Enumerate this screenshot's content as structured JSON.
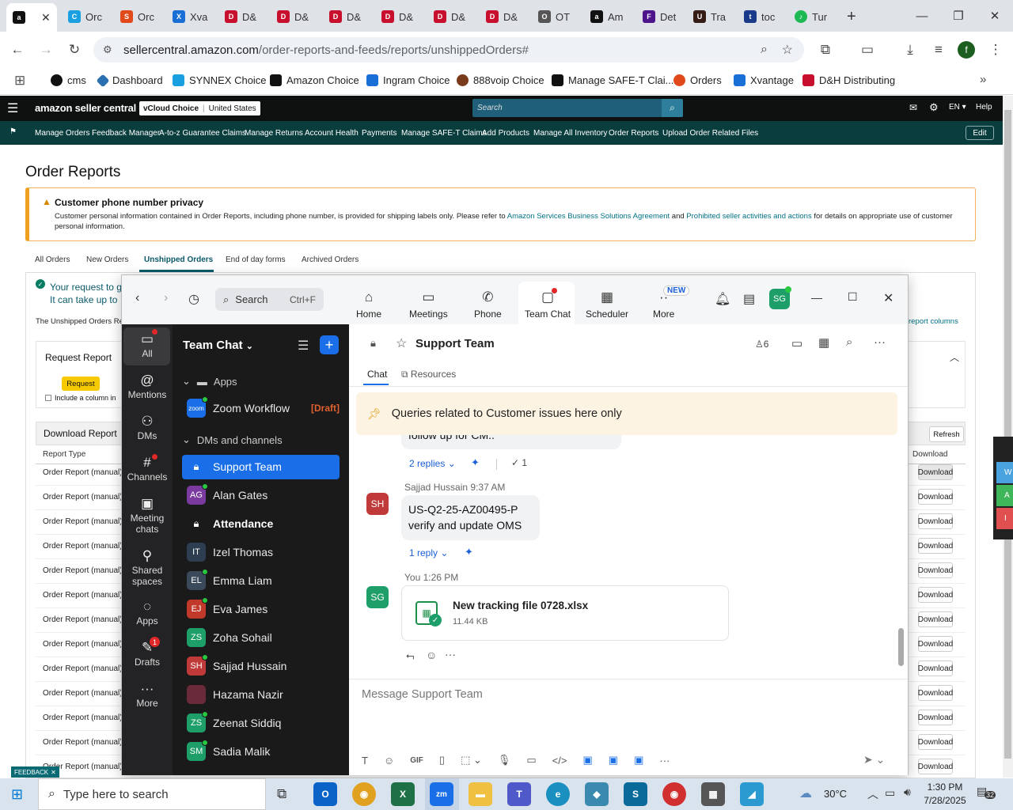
{
  "browser": {
    "tabs": [
      "Orc",
      "Orc",
      "Xva",
      "D&",
      "D&",
      "D&",
      "D&",
      "D&",
      "D&",
      "OT",
      "Am",
      "Det",
      "Tra",
      "toc",
      "Tur"
    ],
    "url_host": "sellercentral.amazon.com",
    "url_path": "/order-reports-and-feeds/reports/unshippedOrders#",
    "bookmarks": [
      "cms",
      "Dashboard",
      "SYNNEX Choice",
      "Amazon Choice",
      "Ingram Choice",
      "888voip Choice",
      "Manage SAFE-T Clai...",
      "Orders",
      "Xvantage",
      "D&H Distributing"
    ],
    "profile_initial": "f"
  },
  "amazon": {
    "logo": "amazon seller central",
    "account": "vCloud Choice",
    "region": "United States",
    "search_placeholder": "Search",
    "lang": "EN",
    "help": "Help",
    "nav": [
      "Manage Orders",
      "Feedback Manager",
      "A-to-z Guarantee Claims",
      "Manage Returns",
      "Account Health",
      "Payments",
      "Manage SAFE-T Claims",
      "Add Products",
      "Manage All Inventory",
      "Order Reports",
      "Upload Order Related Files"
    ],
    "edit": "Edit",
    "page_title": "Order Reports",
    "privacy_title": "Customer phone number privacy",
    "privacy_text_1": "Customer personal information contained in Order Reports, including phone number, is provided for shipping labels only. Please refer to ",
    "privacy_link_1": "Amazon Services Business Solutions Agreement",
    "privacy_and": " and ",
    "privacy_link_2": "Prohibited seller activities and actions",
    "privacy_text_2": " for details on appropriate use of customer personal information.",
    "tabs": [
      "All Orders",
      "New Orders",
      "Unshipped Orders",
      "End of day forms",
      "Archived Orders"
    ],
    "notice_1": "Your request to g",
    "notice_2": "It can take up to",
    "unshipped_intro": "The Unshipped Orders Re",
    "report_columns": "report columns",
    "request_report": "Request Report",
    "request_btn": "Request",
    "include_col": "Include a column in",
    "download_report": "Download Report",
    "refresh": "Refresh",
    "col_report_type": "Report Type",
    "col_download": "Download",
    "row_type": "Order Report (manual)",
    "row_type_last": "Order Report (manual)",
    "download": "Download",
    "feedback": "FEEDBACK"
  },
  "zoom": {
    "search": "Search",
    "shortcut": "Ctrl+F",
    "tools": [
      "Home",
      "Meetings",
      "Phone",
      "Team Chat",
      "Scheduler",
      "More"
    ],
    "new_badge": "NEW",
    "user_initials": "SG",
    "left": [
      "All",
      "Mentions",
      "DMs",
      "Channels",
      "Meeting chats",
      "Shared spaces",
      "Apps",
      "Drafts",
      "More"
    ],
    "drafts_badge": "1",
    "list_title": "Team Chat",
    "apps_section": "Apps",
    "zoom_workflow": "Zoom Workflow",
    "draft_tag": "[Draft]",
    "dms_section": "DMs and channels",
    "channels": [
      {
        "name": "Support Team",
        "initials": ""
      },
      {
        "name": "Alan Gates",
        "initials": "AG"
      },
      {
        "name": "Attendance",
        "initials": ""
      },
      {
        "name": "Izel Thomas",
        "initials": "IT"
      },
      {
        "name": "Emma Liam",
        "initials": "EL"
      },
      {
        "name": "Eva James",
        "initials": "EJ"
      },
      {
        "name": "Zoha Sohail",
        "initials": "ZS"
      },
      {
        "name": "Sajjad Hussain",
        "initials": "SH"
      },
      {
        "name": "Hazama Nazir",
        "initials": ""
      },
      {
        "name": "Zeenat Siddiq",
        "initials": "ZS"
      },
      {
        "name": "Sadia Malik",
        "initials": "SM"
      }
    ],
    "chat_title": "Support Team",
    "members": "6",
    "tab_chat": "Chat",
    "tab_resources": "Resources",
    "pinned": "Queries related to Customer issues here only",
    "prev_msg_tail": "follow up for CM..",
    "replies_2": "2 replies",
    "check_count": "1",
    "msg_sender": "Sajjad Hussain",
    "msg_time": "9:37 AM",
    "msg_line1": "US-Q2-25-AZ00495-P",
    "msg_line2": "verify and update OMS",
    "reply_1": "1 reply",
    "you": "You",
    "you_time": "1:26 PM",
    "file_name": "New tracking file 0728.xlsx",
    "file_size": "11.44 KB",
    "composer_placeholder": "Message Support Team"
  },
  "taskbar": {
    "search_placeholder": "Type here to search",
    "weather": "30°C",
    "time": "1:30 PM",
    "date": "7/28/2025",
    "notif_count": "32"
  }
}
